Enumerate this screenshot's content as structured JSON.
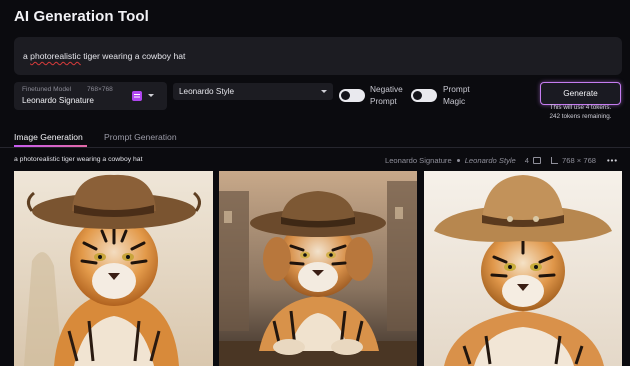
{
  "app": {
    "title": "AI Generation Tool"
  },
  "prompt": {
    "before": "a ",
    "squiggle_word": "photorealistic",
    "after": " tiger wearing a cowboy hat"
  },
  "model": {
    "label": "Finetuned Model",
    "size": "768×768",
    "value": "Leonardo Signature",
    "badge_icon": "model-badge-icon",
    "badge_color": "#b046f0"
  },
  "style": {
    "value": "Leonardo Style"
  },
  "toggles": {
    "negative": {
      "label": "Negative Prompt",
      "on": false
    },
    "magic": {
      "label": "Prompt Magic",
      "on": false
    }
  },
  "generate": {
    "label": "Generate",
    "note1": "This will use 4 tokens.",
    "note2": "242 tokens remaining.",
    "accent": "#c57cf0"
  },
  "tabs": [
    {
      "label": "Image Generation",
      "active": true
    },
    {
      "label": "Prompt Generation",
      "active": false
    }
  ],
  "generation": {
    "prompt": "a photorealistic tiger wearing a cowboy hat",
    "model": "Leonardo Signature",
    "style": "Leonardo Style",
    "count": "4",
    "size": "768 × 768",
    "more": "•••"
  },
  "images": [
    {
      "name": "tiger-image-1",
      "icon": "tiger-image"
    },
    {
      "name": "tiger-image-2",
      "icon": "tiger-image"
    },
    {
      "name": "tiger-image-3",
      "icon": "tiger-image"
    }
  ]
}
